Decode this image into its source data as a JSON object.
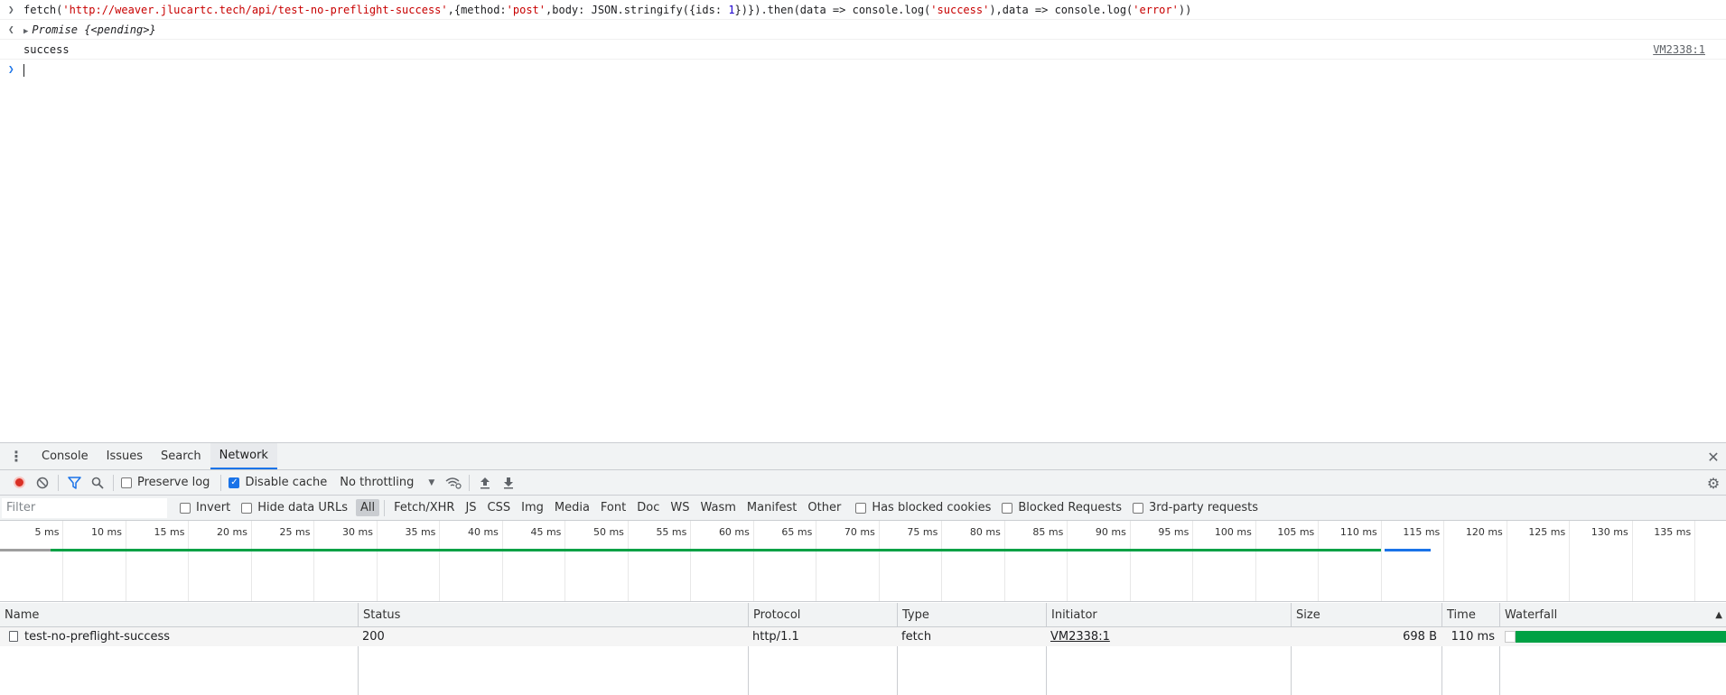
{
  "console": {
    "input_line": {
      "p1": "fetch(",
      "url": "'http://weaver.jlucartc.tech/api/test-no-preflight-success'",
      "p2": ",{method:",
      "method": "'post'",
      "p3": ",body: JSON.stringify({ids: ",
      "num": "1",
      "p4": "})}).then(data => console.log(",
      "success_str": "'success'",
      "p5": "),data => console.log(",
      "error_str": "'error'",
      "p6": "))"
    },
    "result": {
      "label": "Promise",
      "value": "{<pending>}"
    },
    "log": {
      "text": "success",
      "source": "VM2338:1"
    }
  },
  "drawer": {
    "tabs": [
      "Console",
      "Issues",
      "Search",
      "Network"
    ],
    "active_tab": "Network"
  },
  "toolbar": {
    "preserve_log": "Preserve log",
    "preserve_log_checked": false,
    "disable_cache": "Disable cache",
    "disable_cache_checked": true,
    "throttling": "No throttling"
  },
  "filterbar": {
    "placeholder": "Filter",
    "invert": "Invert",
    "hide_data_urls": "Hide data URLs",
    "types": [
      "All",
      "Fetch/XHR",
      "JS",
      "CSS",
      "Img",
      "Media",
      "Font",
      "Doc",
      "WS",
      "Wasm",
      "Manifest",
      "Other"
    ],
    "active_type": "All",
    "has_blocked_cookies": "Has blocked cookies",
    "blocked_requests": "Blocked Requests",
    "third_party": "3rd-party requests"
  },
  "overview": {
    "tick_labels": [
      "5 ms",
      "10 ms",
      "15 ms",
      "20 ms",
      "25 ms",
      "30 ms",
      "35 ms",
      "40 ms",
      "45 ms",
      "50 ms",
      "55 ms",
      "60 ms",
      "65 ms",
      "70 ms",
      "75 ms",
      "80 ms",
      "85 ms",
      "90 ms",
      "95 ms",
      "100 ms",
      "105 ms",
      "110 ms",
      "115 ms",
      "120 ms",
      "125 ms",
      "130 ms",
      "135 ms"
    ],
    "request_start_ms": 4,
    "download_start_ms": 110,
    "request_end_ms": 114,
    "colors": {
      "waiting": "#00a145",
      "download": "#1a73e8",
      "queue": "#9e9e9e"
    }
  },
  "table": {
    "headers": {
      "name": "Name",
      "status": "Status",
      "protocol": "Protocol",
      "type": "Type",
      "initiator": "Initiator",
      "size": "Size",
      "time": "Time",
      "waterfall": "Waterfall"
    },
    "rows": [
      {
        "name": "test-no-preflight-success",
        "status": "200",
        "protocol": "http/1.1",
        "type": "fetch",
        "initiator": "VM2338:1",
        "size": "698 B",
        "time": "110 ms"
      }
    ]
  }
}
